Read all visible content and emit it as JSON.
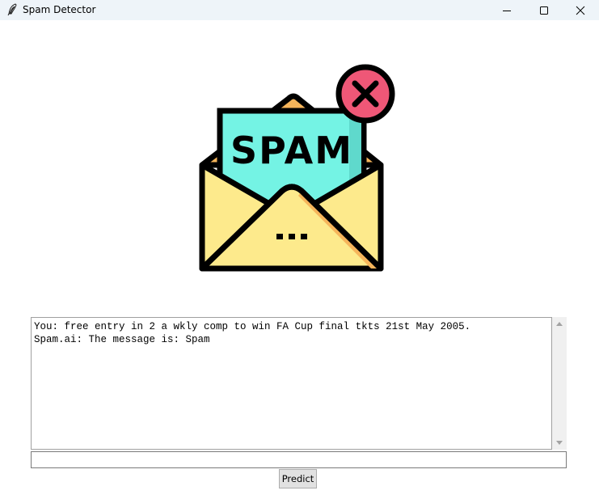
{
  "window": {
    "title": "Spam Detector",
    "app_icon": "feather-icon",
    "controls": {
      "minimize_icon": "minimize-icon",
      "maximize_icon": "maximize-icon",
      "close_icon": "close-icon"
    }
  },
  "logo": {
    "text": "SPAM",
    "icon": "spam-envelope-icon",
    "badge_icon": "x-circle-icon",
    "colors": {
      "letter": "#74f3e4",
      "envelope": "#fdea8c",
      "envelope_shade": "#f6b55b",
      "badge": "#ef5777",
      "outline": "#000000"
    }
  },
  "chat": {
    "lines": [
      "You: free entry in 2 a wkly comp to win FA Cup final tkts 21st May 2005.",
      "Spam.ai: The message is: Spam"
    ]
  },
  "input": {
    "value": ""
  },
  "predict_button": {
    "label": "Predict"
  }
}
